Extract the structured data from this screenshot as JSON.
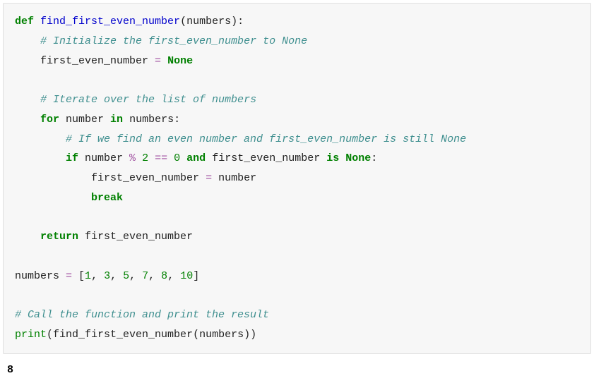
{
  "code": {
    "l1": {
      "k_def": "def",
      "fn": "find_first_even_number",
      "params": "(numbers):"
    },
    "l2": {
      "cm": "# Initialize the first_even_number to None"
    },
    "l3": {
      "v": "first_even_number ",
      "op": "=",
      "sp": " ",
      "none": "None"
    },
    "l4": {
      "cm": "# Iterate over the list of numbers"
    },
    "l5": {
      "k_for": "for",
      "sp1": " number ",
      "k_in": "in",
      "sp2": " numbers:"
    },
    "l6": {
      "cm": "# If we find an even number and first_even_number is still None"
    },
    "l7": {
      "k_if": "if",
      "sp1": " number ",
      "op1": "%",
      "sp2": " ",
      "n2": "2",
      "sp3": " ",
      "op2": "==",
      "sp4": " ",
      "n0": "0",
      "sp5": " ",
      "k_and": "and",
      "sp6": " first_even_number ",
      "k_is": "is",
      "sp7": " ",
      "none": "None",
      "colon": ":"
    },
    "l8": {
      "assign": "first_even_number ",
      "op": "=",
      "rest": " number"
    },
    "l9": {
      "k_break": "break"
    },
    "l10": {
      "k_return": "return",
      "rest": " first_even_number"
    },
    "l11": {
      "v": "numbers ",
      "op": "=",
      "sp": " [",
      "n1": "1",
      "c1": ", ",
      "n3": "3",
      "c2": ", ",
      "n5": "5",
      "c3": ", ",
      "n7": "7",
      "c4": ", ",
      "n8": "8",
      "c5": ", ",
      "n10": "10",
      "close": "]"
    },
    "l12": {
      "cm": "# Call the function and print the result"
    },
    "l13": {
      "print": "print",
      "open": "(",
      "call": "find_first_even_number(numbers))"
    }
  },
  "output": "8"
}
